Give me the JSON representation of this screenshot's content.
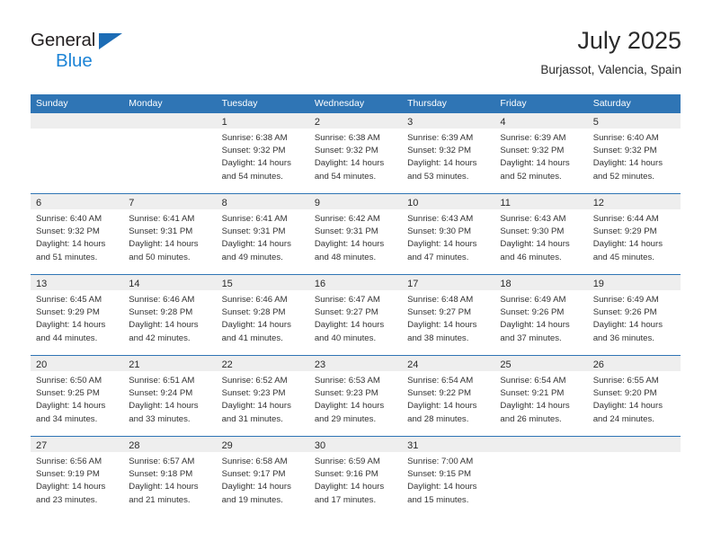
{
  "brand": {
    "name_top": "General",
    "name_bottom": "Blue",
    "triangle_color": "#1c6cb5",
    "blue_color": "#1d84d6"
  },
  "header": {
    "month_title": "July 2025",
    "location": "Burjassot, Valencia, Spain"
  },
  "theme": {
    "header_blue": "#2f75b5",
    "day_band_gray": "#eeeeee",
    "text_color": "#333333"
  },
  "weekdays": [
    "Sunday",
    "Monday",
    "Tuesday",
    "Wednesday",
    "Thursday",
    "Friday",
    "Saturday"
  ],
  "weeks": [
    [
      {
        "day": "",
        "empty": true,
        "lines": []
      },
      {
        "day": "",
        "empty": true,
        "lines": []
      },
      {
        "day": "1",
        "empty": false,
        "lines": [
          "Sunrise: 6:38 AM",
          "Sunset: 9:32 PM",
          "Daylight: 14 hours",
          "and 54 minutes."
        ]
      },
      {
        "day": "2",
        "empty": false,
        "lines": [
          "Sunrise: 6:38 AM",
          "Sunset: 9:32 PM",
          "Daylight: 14 hours",
          "and 54 minutes."
        ]
      },
      {
        "day": "3",
        "empty": false,
        "lines": [
          "Sunrise: 6:39 AM",
          "Sunset: 9:32 PM",
          "Daylight: 14 hours",
          "and 53 minutes."
        ]
      },
      {
        "day": "4",
        "empty": false,
        "lines": [
          "Sunrise: 6:39 AM",
          "Sunset: 9:32 PM",
          "Daylight: 14 hours",
          "and 52 minutes."
        ]
      },
      {
        "day": "5",
        "empty": false,
        "lines": [
          "Sunrise: 6:40 AM",
          "Sunset: 9:32 PM",
          "Daylight: 14 hours",
          "and 52 minutes."
        ]
      }
    ],
    [
      {
        "day": "6",
        "empty": false,
        "lines": [
          "Sunrise: 6:40 AM",
          "Sunset: 9:32 PM",
          "Daylight: 14 hours",
          "and 51 minutes."
        ]
      },
      {
        "day": "7",
        "empty": false,
        "lines": [
          "Sunrise: 6:41 AM",
          "Sunset: 9:31 PM",
          "Daylight: 14 hours",
          "and 50 minutes."
        ]
      },
      {
        "day": "8",
        "empty": false,
        "lines": [
          "Sunrise: 6:41 AM",
          "Sunset: 9:31 PM",
          "Daylight: 14 hours",
          "and 49 minutes."
        ]
      },
      {
        "day": "9",
        "empty": false,
        "lines": [
          "Sunrise: 6:42 AM",
          "Sunset: 9:31 PM",
          "Daylight: 14 hours",
          "and 48 minutes."
        ]
      },
      {
        "day": "10",
        "empty": false,
        "lines": [
          "Sunrise: 6:43 AM",
          "Sunset: 9:30 PM",
          "Daylight: 14 hours",
          "and 47 minutes."
        ]
      },
      {
        "day": "11",
        "empty": false,
        "lines": [
          "Sunrise: 6:43 AM",
          "Sunset: 9:30 PM",
          "Daylight: 14 hours",
          "and 46 minutes."
        ]
      },
      {
        "day": "12",
        "empty": false,
        "lines": [
          "Sunrise: 6:44 AM",
          "Sunset: 9:29 PM",
          "Daylight: 14 hours",
          "and 45 minutes."
        ]
      }
    ],
    [
      {
        "day": "13",
        "empty": false,
        "lines": [
          "Sunrise: 6:45 AM",
          "Sunset: 9:29 PM",
          "Daylight: 14 hours",
          "and 44 minutes."
        ]
      },
      {
        "day": "14",
        "empty": false,
        "lines": [
          "Sunrise: 6:46 AM",
          "Sunset: 9:28 PM",
          "Daylight: 14 hours",
          "and 42 minutes."
        ]
      },
      {
        "day": "15",
        "empty": false,
        "lines": [
          "Sunrise: 6:46 AM",
          "Sunset: 9:28 PM",
          "Daylight: 14 hours",
          "and 41 minutes."
        ]
      },
      {
        "day": "16",
        "empty": false,
        "lines": [
          "Sunrise: 6:47 AM",
          "Sunset: 9:27 PM",
          "Daylight: 14 hours",
          "and 40 minutes."
        ]
      },
      {
        "day": "17",
        "empty": false,
        "lines": [
          "Sunrise: 6:48 AM",
          "Sunset: 9:27 PM",
          "Daylight: 14 hours",
          "and 38 minutes."
        ]
      },
      {
        "day": "18",
        "empty": false,
        "lines": [
          "Sunrise: 6:49 AM",
          "Sunset: 9:26 PM",
          "Daylight: 14 hours",
          "and 37 minutes."
        ]
      },
      {
        "day": "19",
        "empty": false,
        "lines": [
          "Sunrise: 6:49 AM",
          "Sunset: 9:26 PM",
          "Daylight: 14 hours",
          "and 36 minutes."
        ]
      }
    ],
    [
      {
        "day": "20",
        "empty": false,
        "lines": [
          "Sunrise: 6:50 AM",
          "Sunset: 9:25 PM",
          "Daylight: 14 hours",
          "and 34 minutes."
        ]
      },
      {
        "day": "21",
        "empty": false,
        "lines": [
          "Sunrise: 6:51 AM",
          "Sunset: 9:24 PM",
          "Daylight: 14 hours",
          "and 33 minutes."
        ]
      },
      {
        "day": "22",
        "empty": false,
        "lines": [
          "Sunrise: 6:52 AM",
          "Sunset: 9:23 PM",
          "Daylight: 14 hours",
          "and 31 minutes."
        ]
      },
      {
        "day": "23",
        "empty": false,
        "lines": [
          "Sunrise: 6:53 AM",
          "Sunset: 9:23 PM",
          "Daylight: 14 hours",
          "and 29 minutes."
        ]
      },
      {
        "day": "24",
        "empty": false,
        "lines": [
          "Sunrise: 6:54 AM",
          "Sunset: 9:22 PM",
          "Daylight: 14 hours",
          "and 28 minutes."
        ]
      },
      {
        "day": "25",
        "empty": false,
        "lines": [
          "Sunrise: 6:54 AM",
          "Sunset: 9:21 PM",
          "Daylight: 14 hours",
          "and 26 minutes."
        ]
      },
      {
        "day": "26",
        "empty": false,
        "lines": [
          "Sunrise: 6:55 AM",
          "Sunset: 9:20 PM",
          "Daylight: 14 hours",
          "and 24 minutes."
        ]
      }
    ],
    [
      {
        "day": "27",
        "empty": false,
        "lines": [
          "Sunrise: 6:56 AM",
          "Sunset: 9:19 PM",
          "Daylight: 14 hours",
          "and 23 minutes."
        ]
      },
      {
        "day": "28",
        "empty": false,
        "lines": [
          "Sunrise: 6:57 AM",
          "Sunset: 9:18 PM",
          "Daylight: 14 hours",
          "and 21 minutes."
        ]
      },
      {
        "day": "29",
        "empty": false,
        "lines": [
          "Sunrise: 6:58 AM",
          "Sunset: 9:17 PM",
          "Daylight: 14 hours",
          "and 19 minutes."
        ]
      },
      {
        "day": "30",
        "empty": false,
        "lines": [
          "Sunrise: 6:59 AM",
          "Sunset: 9:16 PM",
          "Daylight: 14 hours",
          "and 17 minutes."
        ]
      },
      {
        "day": "31",
        "empty": false,
        "lines": [
          "Sunrise: 7:00 AM",
          "Sunset: 9:15 PM",
          "Daylight: 14 hours",
          "and 15 minutes."
        ]
      },
      {
        "day": "",
        "empty": true,
        "lines": []
      },
      {
        "day": "",
        "empty": true,
        "lines": []
      }
    ]
  ]
}
